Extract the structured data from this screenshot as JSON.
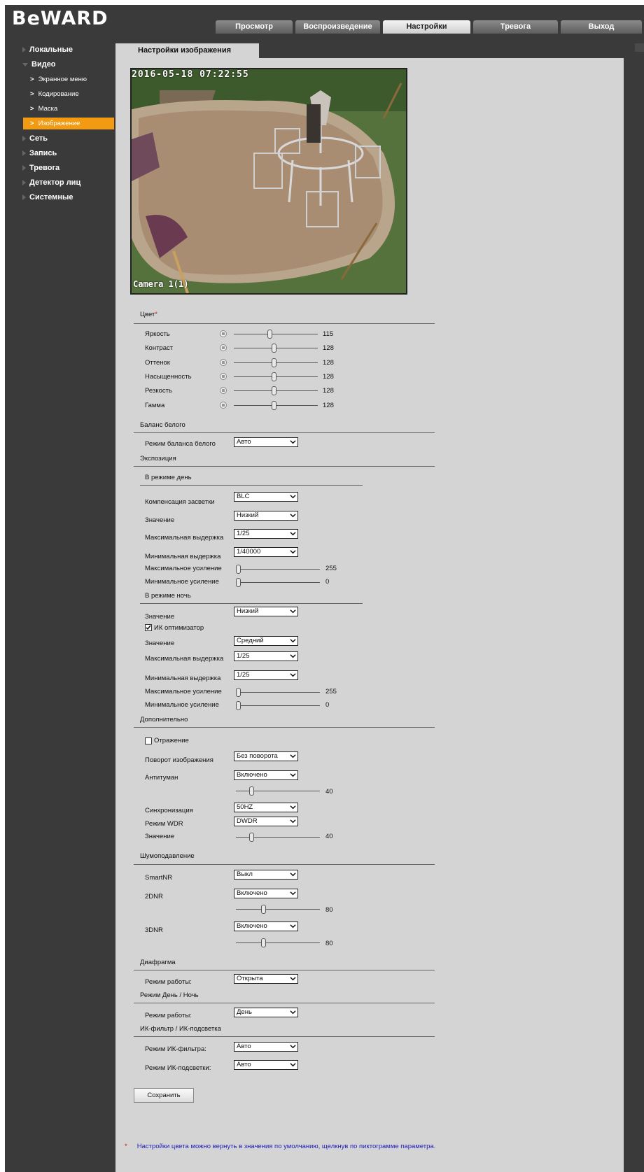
{
  "brand": "BeWARD",
  "tabs": [
    "Просмотр",
    "Воспроизведение",
    "Настройки",
    "Тревога",
    "Выход"
  ],
  "active_tab": "Настройки",
  "sidebar": {
    "items": [
      {
        "label": "Локальные"
      },
      {
        "label": "Видео"
      },
      {
        "label": "Сеть"
      },
      {
        "label": "Запись"
      },
      {
        "label": "Тревога"
      },
      {
        "label": "Детектор лиц"
      },
      {
        "label": "Системные"
      }
    ],
    "video_sub": [
      "Экранное меню",
      "Кодирование",
      "Маска",
      "Изображение"
    ],
    "active_sub": "Изображение"
  },
  "page_tab": "Настройки изображения",
  "video": {
    "timestamp": "2016-05-18 07:22:55",
    "camera_label": "Camera 1(1)"
  },
  "color": {
    "title": "Цвет",
    "title_mark": "*",
    "rows": [
      {
        "label": "Яркость",
        "value": 115,
        "pos": 0.45,
        "icon": "brightness-icon"
      },
      {
        "label": "Контраст",
        "value": 128,
        "pos": 0.5,
        "icon": "contrast-icon"
      },
      {
        "label": "Оттенок",
        "value": 128,
        "pos": 0.5,
        "icon": "hue-icon"
      },
      {
        "label": "Насыщенность",
        "value": 128,
        "pos": 0.5,
        "icon": "saturation-icon"
      },
      {
        "label": "Резкость",
        "value": 128,
        "pos": 0.5,
        "icon": "sharpness-icon"
      },
      {
        "label": "Гамма",
        "value": 128,
        "pos": 0.5,
        "icon": "gamma-icon"
      }
    ]
  },
  "wb": {
    "title": "Баланс белого",
    "mode_label": "Режим баланса белого",
    "mode_value": "Авто"
  },
  "exposure": {
    "title": "Экспозиция",
    "day_title": "В режиме день",
    "blc_label": "Компенсация засветки",
    "blc_value": "BLC",
    "level_label": "Значение",
    "level_value": "Низкий",
    "max_shutter_label": "Максимальная выдержка",
    "max_shutter_value": "1/25",
    "min_shutter_label": "Минимальная выдержка",
    "min_shutter_value": "1/40000",
    "max_gain_label": "Максимальное усиление",
    "max_gain_value": 255,
    "min_gain_label": "Минимальное усиление",
    "min_gain_value": 0,
    "night_title": "В режиме ночь",
    "night_level_label": "Значение",
    "night_level_value": "Низкий",
    "ir_opt_label": "ИК оптимизатор",
    "ir_opt_level_label": "Значение",
    "ir_opt_level_value": "Средний",
    "night_max_shutter_label": "Максимальная выдержка",
    "night_max_shutter_value": "1/25",
    "night_min_shutter_label": "Минимальная выдержка",
    "night_min_shutter_value": "1/25",
    "night_max_gain_label": "Максимальное усиление",
    "night_max_gain_value": 255,
    "night_min_gain_label": "Минимальное усиление",
    "night_min_gain_value": 0
  },
  "extra": {
    "title": "Дополнительно",
    "mirror_label": "Отражение",
    "rotate_label": "Поворот изображения",
    "rotate_value": "Без поворота",
    "defog_label": "Антитуман",
    "defog_value": "Включено",
    "defog_level": 40,
    "sync_label": "Синхронизация",
    "sync_value": "50HZ",
    "wdr_label": "Режим WDR",
    "wdr_value": "DWDR",
    "wdr_level_label": "Значение",
    "wdr_level": 40
  },
  "noise": {
    "title": "Шумоподавление",
    "smartnr_label": "SmartNR",
    "smartnr_value": "Выкл",
    "dnr2_label": "2DNR",
    "dnr2_value": "Включено",
    "dnr2_level": 80,
    "dnr3_label": "3DNR",
    "dnr3_value": "Включено",
    "dnr3_level": 80
  },
  "iris": {
    "title": "Диафрагма",
    "mode_label": "Режим работы:",
    "mode_value": "Открыта"
  },
  "daynight": {
    "title": "Режим День / Ночь",
    "mode_label": "Режим работы:",
    "mode_value": "День"
  },
  "ir": {
    "title": "ИК-фильтр / ИК-подсветка",
    "filter_label": "Режим ИК-фильтра:",
    "filter_value": "Авто",
    "light_label": "Режим ИК-подсветки:",
    "light_value": "Авто"
  },
  "save_label": "Сохранить",
  "note_mark": "*",
  "note": "Настройки цвета можно вернуть в значения по умолчанию, щелкнув по пиктограмме параметра.",
  "colors": {
    "accent": "#f29a12",
    "frame": "#3a3a3a",
    "panel": "#d4d4d4",
    "note": "#1d1db8"
  }
}
